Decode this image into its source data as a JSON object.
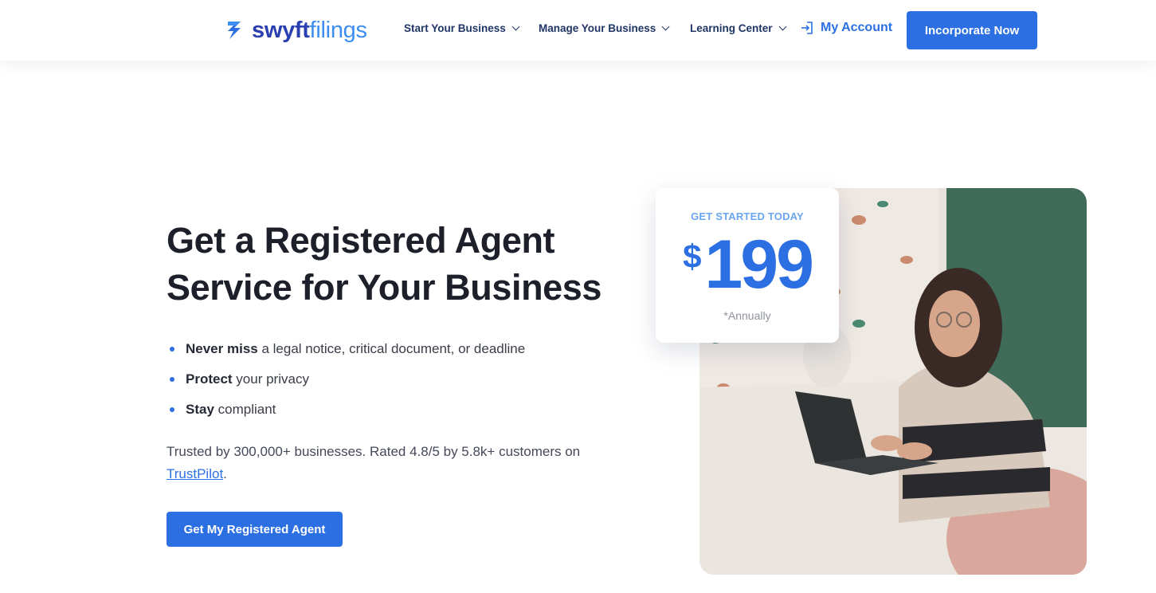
{
  "header": {
    "logo": {
      "part1": "swyft",
      "part2": "filings"
    },
    "nav": [
      {
        "label": "Start Your Business"
      },
      {
        "label": "Manage Your Business"
      },
      {
        "label": "Learning Center"
      }
    ],
    "account_label": "My Account",
    "cta_label": "Incorporate Now"
  },
  "hero": {
    "title": "Get a Registered Agent Service for Your Business",
    "bullets": [
      {
        "bold": "Never miss",
        "rest": " a legal notice, critical document, or deadline"
      },
      {
        "bold": "Protect",
        "rest": " your privacy"
      },
      {
        "bold": "Stay",
        "rest": " compliant"
      }
    ],
    "trust_text": "Trusted by 300,000+ businesses. Rated 4.8/5 by 5.8k+ customers on ",
    "trust_link": "TrustPilot",
    "trust_end": ".",
    "cta_label": "Get My Registered Agent"
  },
  "price_card": {
    "label": "GET STARTED TODAY",
    "currency": "$",
    "amount": "199",
    "note": "*Annually"
  },
  "colors": {
    "primary": "#2c6fe3",
    "nav_text": "#1f3566",
    "heading": "#1d1f2a"
  }
}
